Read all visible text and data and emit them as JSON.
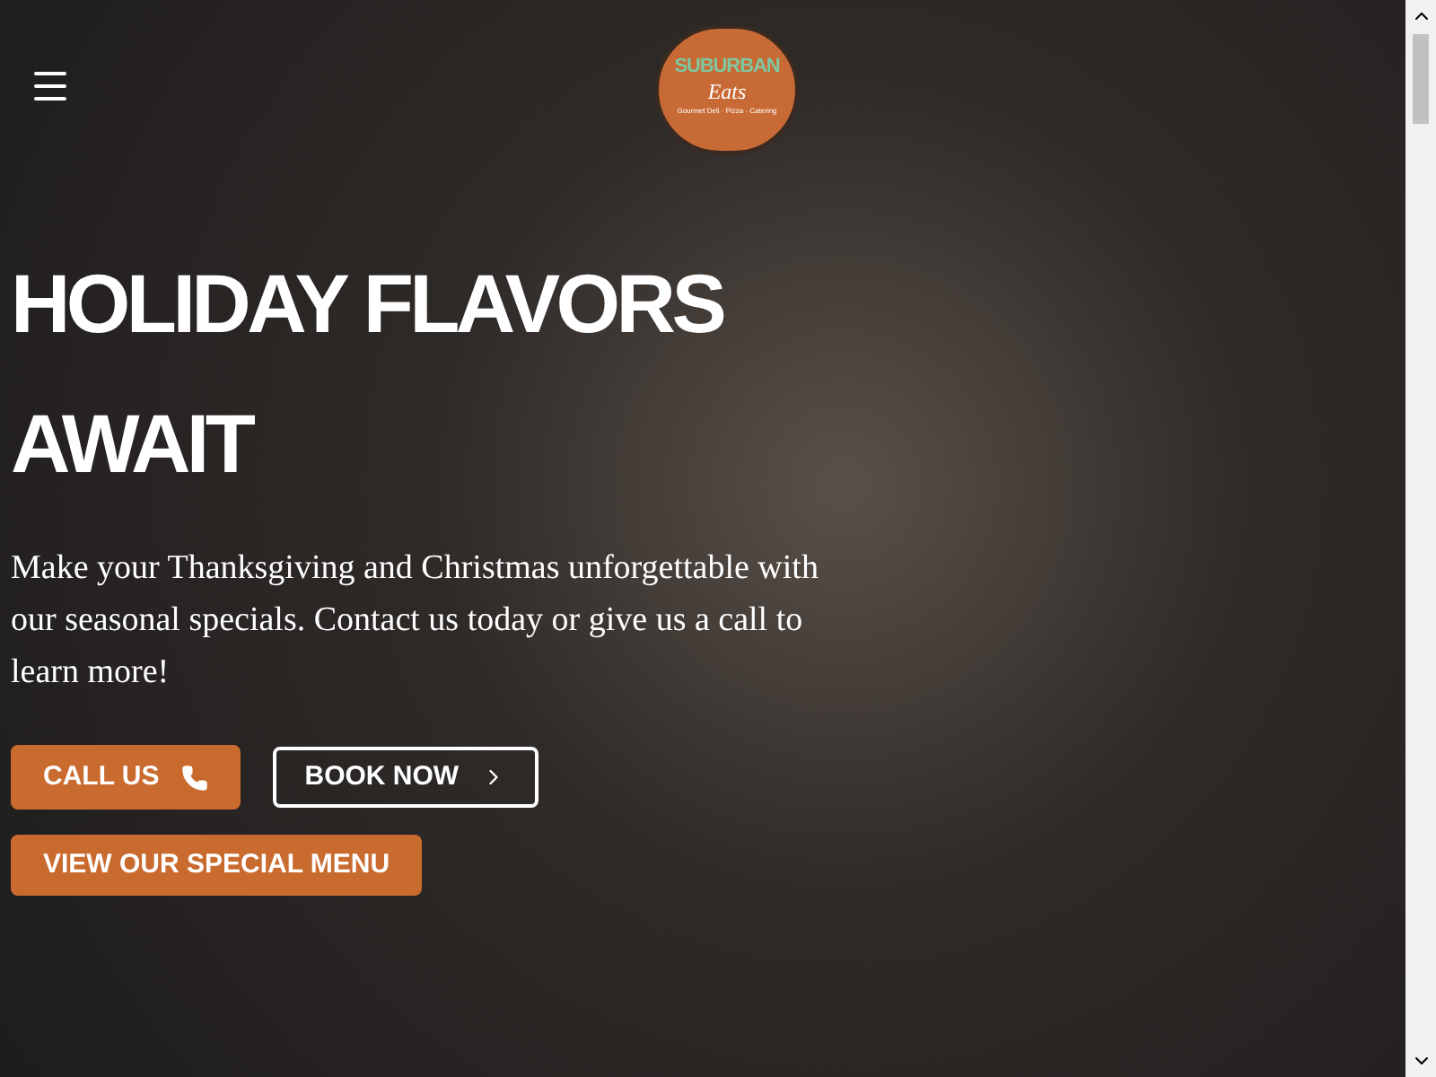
{
  "logo": {
    "name": "SUBURBAN",
    "subtitle": "Eats",
    "tagline": "Gourmet Deli · Pizza · Catering"
  },
  "hero": {
    "title": "HOLIDAY FLAVORS AWAIT",
    "text": "Make your Thanksgiving and Christmas unforgettable with our seasonal specials. Contact us today or give us a call to learn more!"
  },
  "buttons": [
    {
      "label": "CALL US",
      "kind": "call"
    },
    {
      "label": "BOOK NOW",
      "kind": "outline"
    },
    {
      "label": "VIEW OUR SPECIAL MENU",
      "kind": "solid"
    }
  ]
}
